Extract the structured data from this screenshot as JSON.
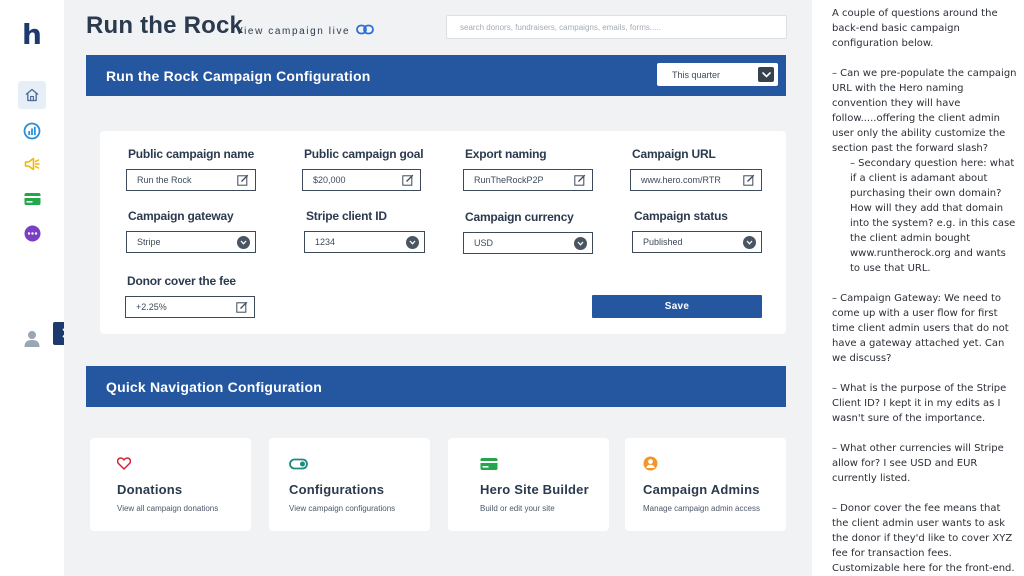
{
  "app": {
    "logo": "h"
  },
  "sidebar": {
    "items": [
      {
        "name": "home-icon",
        "active": true
      },
      {
        "name": "analytics-icon",
        "color": "#2b8fd6"
      },
      {
        "name": "megaphone-icon",
        "color": "#f2b705"
      },
      {
        "name": "card-icon",
        "color": "#22a84a"
      },
      {
        "name": "more-icon",
        "color": "#7b3fc4"
      }
    ],
    "user_icon": "user-icon",
    "expand_icon": "chevron-right-icon"
  },
  "header": {
    "title": "Run the Rock",
    "view_live": "View campaign live",
    "view_live_icon": "link-icon",
    "search_placeholder": "search donors, fundraisers, campaigns, emails, forms....."
  },
  "config": {
    "title": "Run the Rock Campaign Configuration",
    "period": "This quarter",
    "fields": [
      {
        "label": "Public campaign name",
        "value": "Run the Rock",
        "control": "edit"
      },
      {
        "label": "Public campaign goal",
        "value": "$20,000",
        "control": "edit"
      },
      {
        "label": "Export naming",
        "value": "RunTheRockP2P",
        "control": "edit"
      },
      {
        "label": "Campaign URL",
        "value": "www.hero.com/RTR",
        "control": "edit"
      },
      {
        "label": "Campaign gateway",
        "value": "Stripe",
        "control": "select"
      },
      {
        "label": "Stripe client ID",
        "value": "1234",
        "control": "select"
      },
      {
        "label": "Campaign currency",
        "value": "USD",
        "control": "select"
      },
      {
        "label": "Campaign status",
        "value": "Published",
        "control": "select"
      },
      {
        "label": "Donor cover the fee",
        "value": "+2.25%",
        "control": "edit"
      }
    ],
    "save_label": "Save"
  },
  "quick_nav": {
    "title": "Quick Navigation Configuration",
    "cards": [
      {
        "title": "Donations",
        "desc": "View all campaign donations",
        "icon": "heart-icon",
        "color": "#d0253a"
      },
      {
        "title": "Configurations",
        "desc": "View campaign configurations",
        "icon": "toggle-icon",
        "color": "#1d8a80"
      },
      {
        "title": "Hero Site Builder",
        "desc": "Build or edit your site",
        "icon": "card-icon",
        "color": "#22a84a"
      },
      {
        "title": "Campaign Admins",
        "desc": "Manage campaign admin access",
        "icon": "user-circle-icon",
        "color": "#f0962a"
      }
    ]
  },
  "notes": {
    "paragraphs": [
      "A couple of questions around the back-end basic campaign configuration below.",
      "– Can we pre-populate the campaign URL with the Hero naming convention they will have follow.....offering the client admin user only the ability customize the section past the forward slash?",
      "– Campaign Gateway:  We need to come up with a user flow for first time client admin users that do not have a gateway attached yet. Can we discuss?",
      "– What is the purpose of the Stripe Client ID?  I kept it in my edits as I wasn't sure of the importance.",
      "– What other currencies will Stripe allow for?  I see USD and EUR currently listed.",
      "– Donor cover the fee means that the client admin user wants to ask the donor if they'd like to cover XYZ fee for transaction fees. Customizable here for the front-end."
    ],
    "sub_note": "– Secondary question here:  what if a client is adamant about purchasing their own domain? How will they add that domain into the system? e.g. in this case the client admin bought www.runtherock.org and wants to use that URL."
  }
}
